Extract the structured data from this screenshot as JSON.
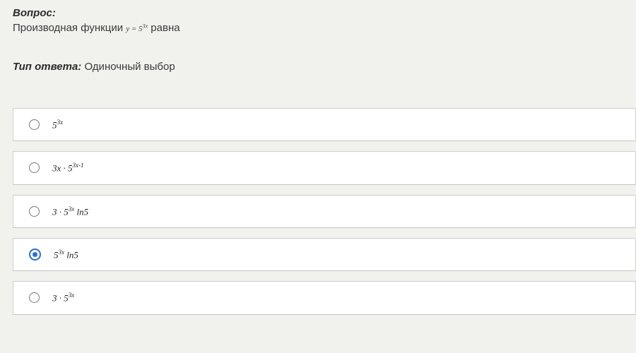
{
  "question": {
    "label": "Вопрос:",
    "text_before": "Производная функции ",
    "formula_html": "y = 5<sup>3x</sup>",
    "text_after": " равна"
  },
  "answer_type": {
    "label": "Тип ответа:",
    "value": "Одиночный выбор"
  },
  "options": [
    {
      "html": "5<sup>3x</sup>",
      "selected": false
    },
    {
      "html": "3x · 5<sup>3x-1</sup>",
      "selected": false
    },
    {
      "html": "3 · 5<sup>3x</sup> ln5",
      "selected": false
    },
    {
      "html": "5<sup>3x</sup> ln5",
      "selected": true
    },
    {
      "html": "3 · 5<sup>3x</sup>",
      "selected": false
    }
  ]
}
